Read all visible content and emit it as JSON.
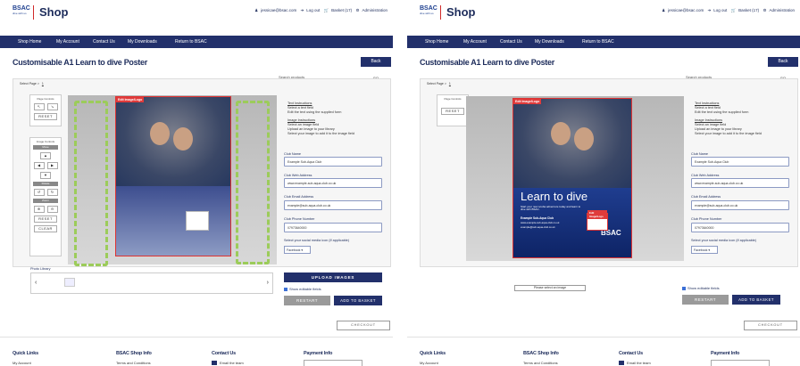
{
  "header": {
    "logo_text": "BSAC",
    "logo_tagline": "dive with us",
    "shop_title": "Shop",
    "user_email": "jessicae@bsac.com",
    "logout_label": "Log out",
    "basket_label": "Basket (17)",
    "admin_label": "Administration"
  },
  "nav": {
    "items": [
      "Shop Home",
      "My Account",
      "Contact Us",
      "My Downloads",
      "Return to BSAC"
    ],
    "search_placeholder": "Search products",
    "search_go": "GO"
  },
  "page": {
    "title": "Customisable A1 Learn to dive Poster",
    "back_label": "Back",
    "select_page_label": "Select Page >",
    "select_page_value": "1"
  },
  "controls": {
    "page_controls_label": "Page Controls",
    "reset_label": "RESET",
    "image_controls_label": "Image Controls",
    "move_label": "Move",
    "rotate_label": "Rotate",
    "zoom_label": "Zoom",
    "clear_label": "CLEAR"
  },
  "poster": {
    "edit_tag": "Edit Image/Logo",
    "headline": "Learn to dive",
    "subtext": "Start your new scuba adventure today and learn to dive with BSAC.",
    "club_name": "Example Sub-Aqua Club",
    "club_web": "www.example-sub-aqua-club.co.uk",
    "club_email": "example@sub-aqua-club.co.uk",
    "brand": "BSAC"
  },
  "instructions": {
    "text_title": "Text Instructions",
    "text_lines": [
      "Select a text field",
      "Edit the text using the supplied form"
    ],
    "image_title": "Image Instructions",
    "image_lines": [
      "Select an image field",
      "Upload an image to your library",
      "Select your image to add it to the image field"
    ]
  },
  "form": {
    "club_name_label": "Club Name",
    "club_name_value": "Example Sub-Aqua Club",
    "web_label": "Club Web Address",
    "web_value": "www.example-sub-aqua-club.co.uk",
    "email_label": "Club Email Address",
    "email_value": "example@sub-aqua-club.co.uk",
    "phone_label": "Club Phone Number",
    "phone_value": "07973640000",
    "social_label": "Select your social media icon (If applicable)",
    "social_value": "Facebook",
    "upload_label": "UPLOAD IMAGES",
    "show_fields_label": "Show editable fields",
    "restart_label": "RESTART",
    "add_basket_label": "ADD TO BASKET",
    "checkout_label": "CHECKOUT"
  },
  "library": {
    "label": "Photo Library",
    "please_select": "Please select an image"
  },
  "footer": {
    "quick_links": "Quick Links",
    "quick_links_sub": "My Account",
    "shop_info": "BSAC Shop Info",
    "shop_info_sub": "Terms and Conditions",
    "contact": "Contact Us",
    "contact_sub": "Email the team",
    "payment": "Payment Info",
    "payment_sub": "Payment by..."
  },
  "colors": {
    "navy": "#22306b",
    "accent_red": "#d02a2a",
    "highlight_green": "#9ccc5a"
  }
}
